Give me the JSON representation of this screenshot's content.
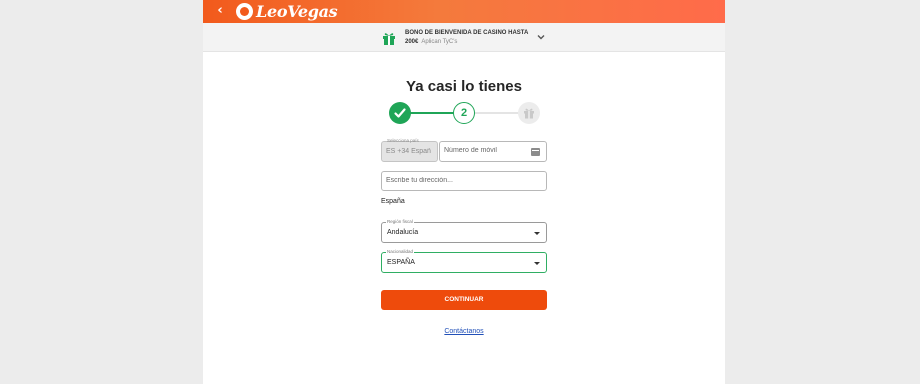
{
  "header": {
    "back_icon": "chevron-left-icon",
    "brand": "LeoVegas",
    "colors": {
      "bar_start": "#f25a1c",
      "bar_end": "#ff6b4a"
    }
  },
  "promo": {
    "icon": "gift-icon",
    "line1": "BONO DE BIENVENIDA DE CASINO HASTA",
    "amount": "200€",
    "terms": "Aplican TyC's",
    "toggle_icon": "chevron-down-icon"
  },
  "form": {
    "title": "Ya casi lo tienes",
    "steps": {
      "current": 2,
      "total": 3,
      "current_label": "2",
      "done_color": "#1fa557"
    },
    "country_code": {
      "label": "Selecciona país",
      "value": "ES +34 Españ"
    },
    "phone": {
      "placeholder": "Número de móvil",
      "icon": "card-icon"
    },
    "address": {
      "placeholder": "Escribe tu dirección..."
    },
    "country_text": "España",
    "region": {
      "label": "Región fiscal",
      "value": "Andalucía"
    },
    "nationality": {
      "label": "Nacionalidad",
      "value": "ESPAÑA"
    },
    "submit_label": "CONTINUAR",
    "submit_color": "#ee4b0c",
    "contact_label": "Contáctanos"
  }
}
